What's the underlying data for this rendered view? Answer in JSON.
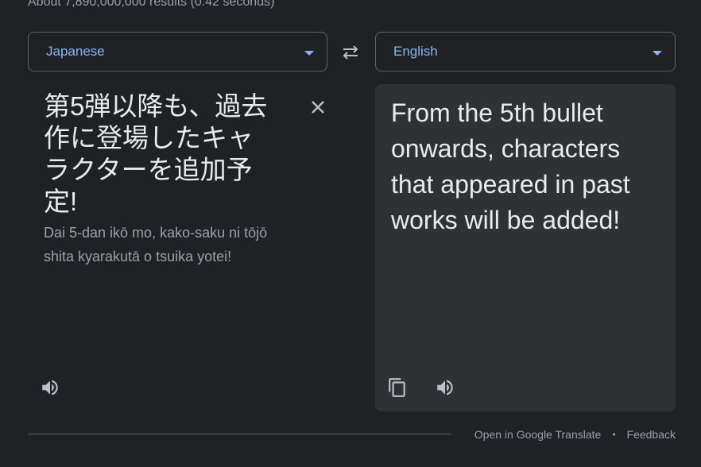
{
  "results_stats": "About 7,890,000,000 results (0.42 seconds)",
  "source_language": {
    "label": "Japanese"
  },
  "target_language": {
    "label": "English"
  },
  "source": {
    "text": "第5弾以降も、過去作に登場したキャラクターを追加予定!",
    "romanization": "Dai 5-dan ikō mo, kako-saku ni tōjō shita kyarakutā o tsuika yotei!"
  },
  "target": {
    "text": "From the 5th bullet onwards, characters that appeared in past works will be added!"
  },
  "icons": {
    "swap": "swap-icon",
    "clear": "close-icon",
    "source_listen": "speaker-icon",
    "copy": "copy-icon",
    "target_listen": "speaker-icon"
  },
  "footer": {
    "open_link": "Open in Google Translate",
    "separator": "•",
    "feedback": "Feedback"
  },
  "colors": {
    "background": "#202124",
    "panel": "#303134",
    "accent": "#8ab4f8",
    "text": "#e8eaed",
    "muted": "#9aa0a6",
    "border": "#5f6368"
  }
}
